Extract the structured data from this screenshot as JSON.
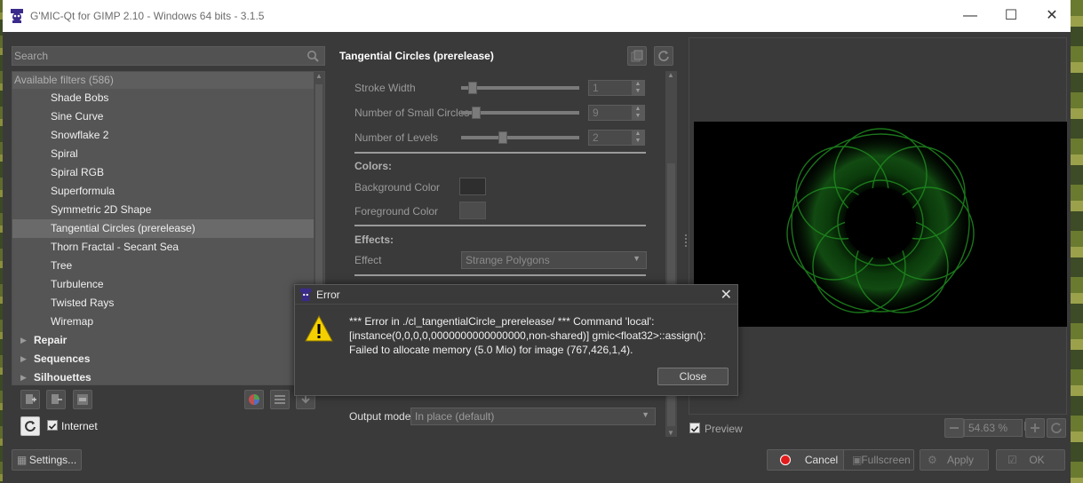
{
  "window": {
    "title": "G'MIC-Qt for GIMP 2.10 - Windows 64 bits - 3.1.5",
    "minimize": "—",
    "maximize": "☐",
    "close": "✕"
  },
  "left": {
    "search_placeholder": "Search",
    "list_header": "Available filters (586)",
    "items": [
      "Shade Bobs",
      "Sine Curve",
      "Snowflake 2",
      "Spiral",
      "Spiral RGB",
      "Superformula",
      "Symmetric 2D Shape",
      "Tangential Circles (prerelease)",
      "Thorn Fractal - Secant Sea",
      "Tree",
      "Turbulence",
      "Twisted Rays",
      "Wiremap"
    ],
    "selected_index": 7,
    "categories": [
      "Repair",
      "Sequences",
      "Silhouettes"
    ],
    "internet_label": "Internet",
    "settings_label": "Settings..."
  },
  "filter": {
    "title": "Tangential Circles (prerelease)",
    "params": {
      "stroke_width_label": "Stroke Width",
      "stroke_width_value": "1",
      "small_circles_label": "Number of Small Circles",
      "small_circles_value": "9",
      "levels_label": "Number of Levels",
      "levels_value": "2",
      "colors_section": "Colors:",
      "bg_color_label": "Background Color",
      "fg_color_label": "Foreground Color",
      "effects_section": "Effects:",
      "effect_label": "Effect",
      "effect_value": "Strange Polygons"
    },
    "output_mode_label": "Output mode",
    "output_mode_value": "In place (default)"
  },
  "preview": {
    "label": "Preview",
    "zoom": "54.63 %"
  },
  "buttons": {
    "cancel": "Cancel",
    "fullscreen": "Fullscreen",
    "apply": "Apply",
    "ok": "OK"
  },
  "dialog": {
    "title": "Error",
    "message": "*** Error in ./cl_tangentialCircle_prerelease/ *** Command 'local': [instance(0,0,0,0,0000000000000000,non-shared)] gmic<float32>::assign(): Failed to allocate memory (5.0 Mio) for image (767,426,1,4).",
    "close_button": "Close"
  },
  "colors": {
    "accent_glow": "#1f8a1f",
    "cancel_icon": "#e31b1b",
    "warning": "#f5d000"
  }
}
